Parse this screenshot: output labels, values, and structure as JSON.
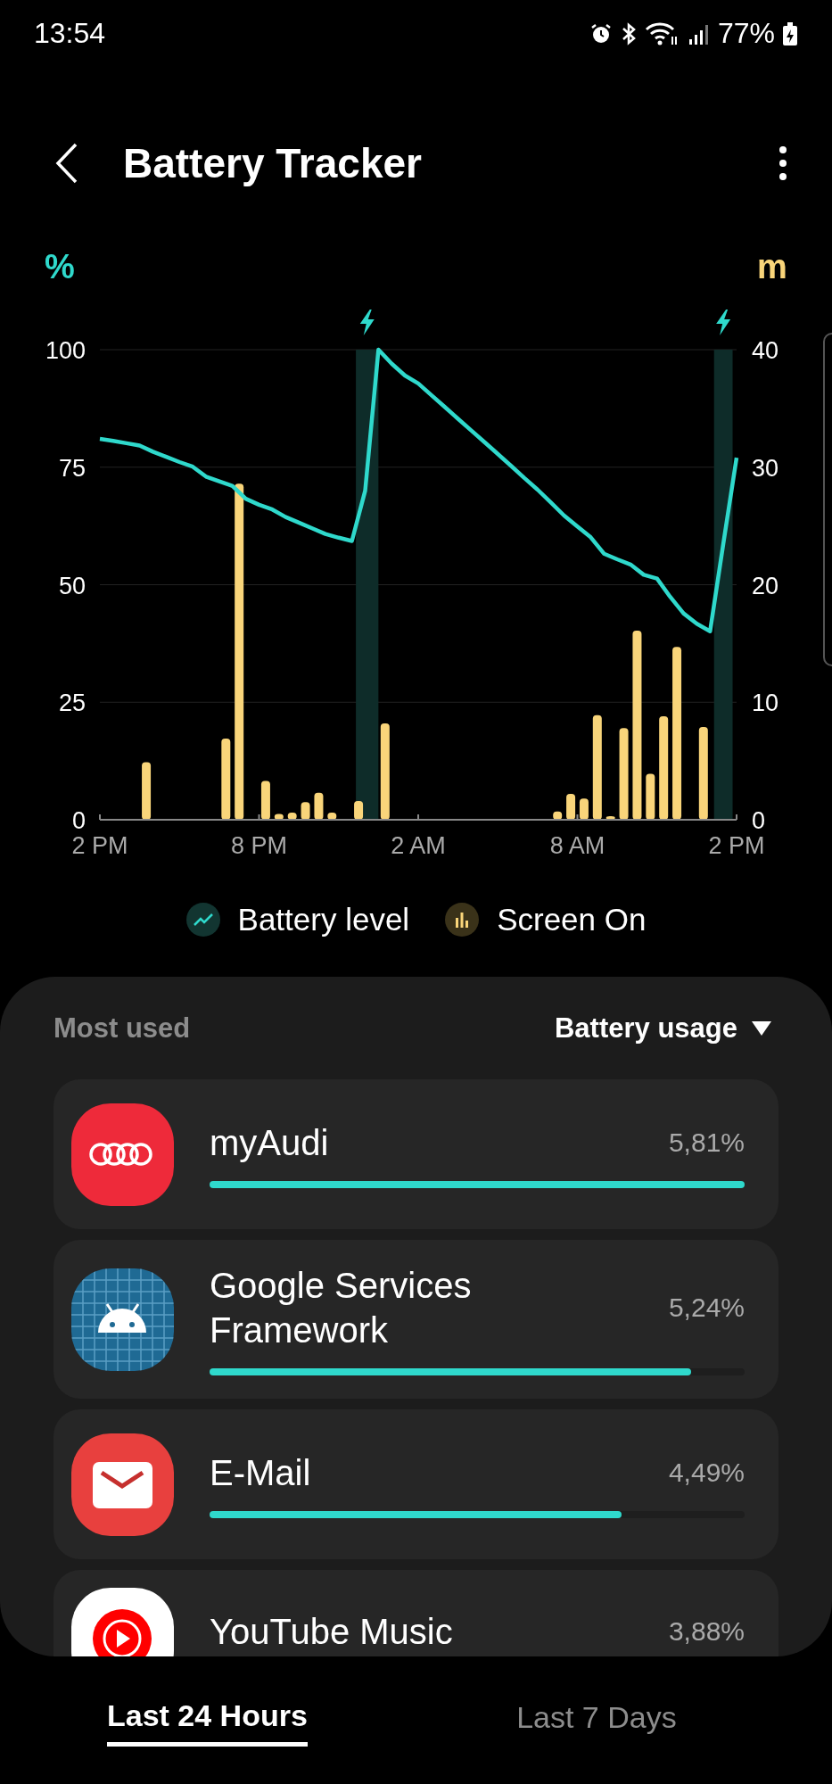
{
  "status_bar": {
    "time": "13:54",
    "battery": "77%"
  },
  "header": {
    "title": "Battery Tracker"
  },
  "chart": {
    "chart_data": {
      "type": "line",
      "grid": true,
      "ylabel": "%",
      "y2label": "m",
      "ylim": [
        0,
        100
      ],
      "y2lim": [
        0,
        40
      ],
      "yticks": [
        0,
        25,
        50,
        75,
        100
      ],
      "y2ticks": [
        0,
        10,
        20,
        30,
        40
      ],
      "categories": [
        "2 PM",
        null,
        null,
        null,
        null,
        null,
        null,
        null,
        null,
        null,
        null,
        null,
        "8 PM",
        null,
        null,
        null,
        null,
        null,
        null,
        null,
        null,
        null,
        null,
        null,
        "2 AM",
        null,
        null,
        null,
        null,
        null,
        null,
        null,
        null,
        null,
        null,
        null,
        "8 AM",
        null,
        null,
        null,
        null,
        null,
        null,
        null,
        null,
        null,
        null,
        null,
        "2 PM"
      ],
      "series": [
        {
          "name": "Battery level",
          "color": "#2fd9cc",
          "values": [
            81,
            80.6,
            80.1,
            79.6,
            78.3,
            77.2,
            76.1,
            75.1,
            73,
            72,
            71,
            68.3,
            67,
            66,
            64.4,
            63.2,
            62,
            60.8,
            60,
            59.3,
            70,
            100,
            97,
            94.5,
            92.8,
            90.3,
            87.8,
            85.3,
            82.8,
            80.3,
            77.8,
            75.3,
            72.7,
            70.2,
            67.5,
            64.7,
            62.4,
            60.1,
            56.6,
            55.4,
            54.3,
            52.1,
            51.3,
            47.4,
            43.9,
            41.7,
            40.1,
            58.7,
            77
          ]
        },
        {
          "name": "Screen On",
          "type": "bar",
          "axis": "y2",
          "color": "#f9d57a",
          "values": [
            null,
            null,
            null,
            4.9,
            null,
            null,
            null,
            null,
            null,
            6.9,
            28.6,
            null,
            3.3,
            0.5,
            0.6,
            1.5,
            2.3,
            0.6,
            null,
            1.6,
            null,
            8.2,
            null,
            null,
            null,
            null,
            null,
            null,
            null,
            null,
            null,
            null,
            null,
            null,
            0.7,
            2.2,
            1.8,
            8.9,
            0.3,
            7.8,
            16.1,
            3.9,
            8.8,
            14.7,
            null,
            7.9,
            null,
            null,
            null
          ]
        }
      ]
    }
  },
  "usage": {
    "title": "Most used",
    "sort": "Battery usage",
    "apps": [
      {
        "name": "myAudi",
        "percent": "5,81%",
        "level": 1.0
      },
      {
        "name": "Google Services Framework",
        "percent": "5,24%",
        "level": 0.9
      },
      {
        "name": "E-Mail",
        "percent": "4,49%",
        "level": 0.77
      },
      {
        "name": "YouTube Music",
        "percent": "3,88%"
      }
    ]
  },
  "tabs": [
    {
      "label": "Last 24 Hours",
      "selected": true
    },
    {
      "label": "Last 7 Days",
      "selected": false
    }
  ]
}
